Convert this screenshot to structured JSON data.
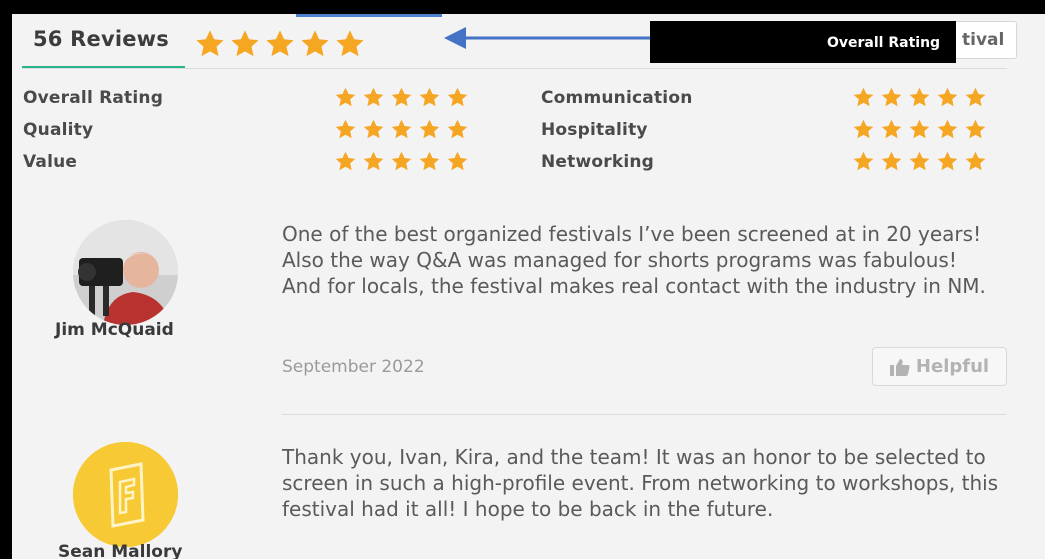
{
  "header": {
    "review_count": "56 Reviews",
    "overall_stars": 5,
    "festival_button_partial": "tival",
    "overlay_label": "Overall Rating"
  },
  "ratings": [
    {
      "label": "Overall Rating",
      "stars": 5
    },
    {
      "label": "Quality",
      "stars": 5
    },
    {
      "label": "Value",
      "stars": 5
    },
    {
      "label": "Communication",
      "stars": 5
    },
    {
      "label": "Hospitality",
      "stars": 5
    },
    {
      "label": "Networking",
      "stars": 5
    }
  ],
  "reviews": [
    {
      "name": "Jim McQuaid",
      "text": "One of the best organized festivals I’ve been screened at in 20 years! Also the way Q&A was managed for shorts programs was fabulous! And for locals, the festival makes real contact with the industry in NM.",
      "date": "September 2022",
      "helpful_label": "Helpful"
    },
    {
      "name": "Sean Mallory",
      "text": "Thank you, Ivan, Kira, and the team! It was an honor to be selected to screen in such a high-profile event. From networking to workshops, this festival had it all! I hope to be back in the future."
    }
  ],
  "colors": {
    "star": "#f5a623",
    "tab_underline": "#27b38c",
    "arrow": "#4472c4",
    "avatar_yellow": "#f7c934"
  },
  "icons": {
    "star": "star-icon",
    "thumb": "thumbs-up-icon",
    "logo": "film-f-logo-icon"
  }
}
